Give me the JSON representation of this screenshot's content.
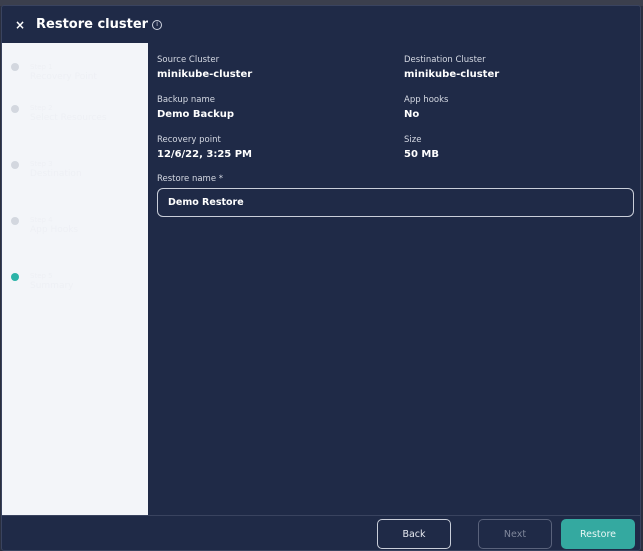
{
  "dialog": {
    "title": "Restore cluster",
    "close_glyph": "×",
    "info_glyph": "i"
  },
  "sidebar": {
    "steps": [
      {
        "number": "Step 1",
        "label": "Recovery Point",
        "active": false
      },
      {
        "number": "Step 2",
        "label": "Select Resources",
        "active": false
      },
      {
        "number": "Step 3",
        "label": "Destination",
        "active": false
      },
      {
        "number": "Step 4",
        "label": "App Hooks",
        "active": false
      },
      {
        "number": "Step 5",
        "label": "Summary",
        "active": true
      }
    ]
  },
  "summary": {
    "source_cluster_label": "Source Cluster",
    "source_cluster_value": "minikube-cluster",
    "destination_cluster_label": "Destination Cluster",
    "destination_cluster_value": "minikube-cluster",
    "backup_name_label": "Backup name",
    "backup_name_value": "Demo Backup",
    "app_hooks_label": "App hooks",
    "app_hooks_value": "No",
    "recovery_point_label": "Recovery point",
    "recovery_point_value": "12/6/22, 3:25 PM",
    "size_label": "Size",
    "size_value": "50 MB",
    "restore_name_label": "Restore name *",
    "restore_name_value": "Demo Restore"
  },
  "footer": {
    "back_label": "Back",
    "next_label": "Next",
    "restore_label": "Restore"
  },
  "colors": {
    "background": "#1f2a47",
    "sidebar": "#f3f5f9",
    "accent": "#34a9a0",
    "active_step": "#2bb3a8"
  }
}
